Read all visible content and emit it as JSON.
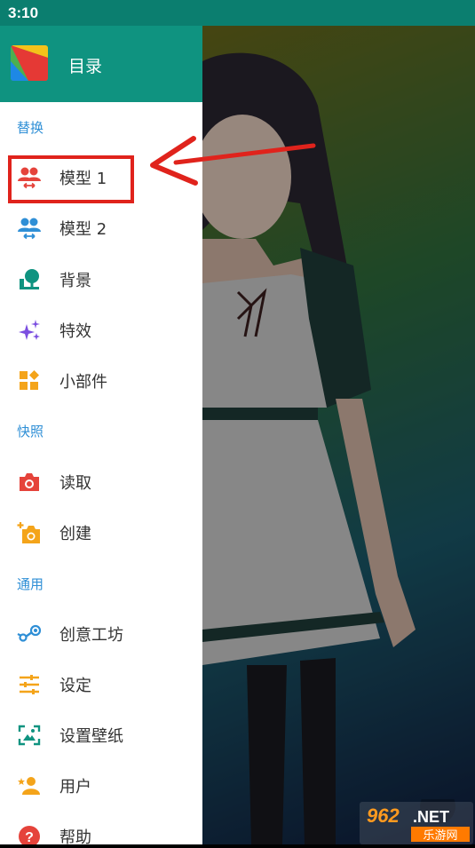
{
  "status": {
    "time": "3:10"
  },
  "drawer": {
    "title": "目录"
  },
  "sections": {
    "replace": "替换",
    "snapshot": "快照",
    "general": "通用"
  },
  "items": [
    {
      "label": "模型 1",
      "icon": "model-swap-icon",
      "color": "#e5433b"
    },
    {
      "label": "模型 2",
      "icon": "model-swap-icon",
      "color": "#2f8fd6"
    },
    {
      "label": "背景",
      "icon": "tree-icon",
      "color": "#0f9380"
    },
    {
      "label": "特效",
      "icon": "sparkles-icon",
      "color": "#7b4ee0"
    },
    {
      "label": "小部件",
      "icon": "widgets-icon",
      "color": "#f4a41a"
    },
    {
      "label": "读取",
      "icon": "camera-icon",
      "color": "#e5433b"
    },
    {
      "label": "创建",
      "icon": "add-camera-icon",
      "color": "#f4a41a"
    },
    {
      "label": "创意工坊",
      "icon": "steam-workshop-icon",
      "color": "#2f8fd6"
    },
    {
      "label": "设定",
      "icon": "sliders-icon",
      "color": "#f4a41a"
    },
    {
      "label": "设置壁纸",
      "icon": "wallpaper-icon",
      "color": "#0f9380"
    },
    {
      "label": "用户",
      "icon": "user-star-icon",
      "color": "#f4a41a"
    },
    {
      "label": "帮助",
      "icon": "help-icon",
      "color": "#e5433b"
    }
  ],
  "watermark": {
    "brand": "962",
    "suffix": ".NET",
    "tagline": "乐游网"
  }
}
